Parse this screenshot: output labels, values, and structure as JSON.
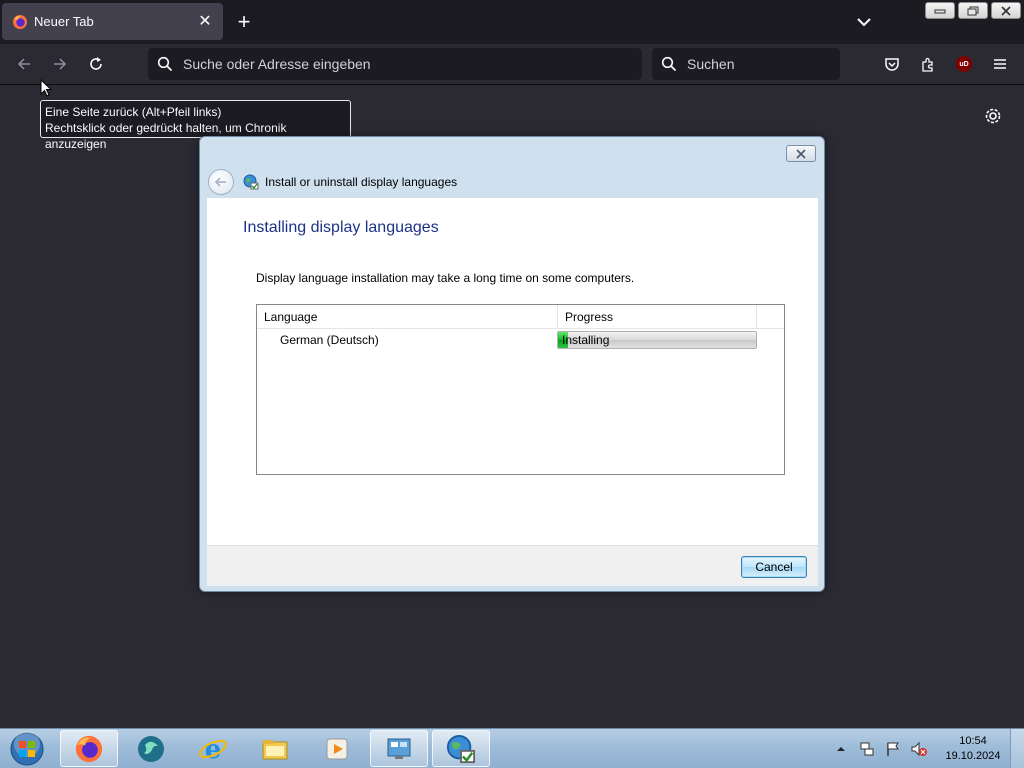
{
  "browser": {
    "tab": {
      "title": "Neuer Tab",
      "icon": "firefox-icon"
    },
    "url_placeholder": "Suche oder Adresse eingeben",
    "search_placeholder": "Suchen",
    "ublock_label": "uD",
    "tooltip": {
      "line1": "Eine Seite zurück (Alt+Pfeil links)",
      "line2": "Rechtsklick oder gedrückt halten, um Chronik anzuzeigen"
    }
  },
  "dialog": {
    "title": "Install or uninstall display languages",
    "heading": "Installing display languages",
    "description": "Display language installation may take a long time on some computers.",
    "columns": [
      "Language",
      "Progress"
    ],
    "rows": [
      {
        "language": "German (Deutsch)",
        "progress_label": "Installing",
        "progress_fraction": 0.05
      }
    ],
    "cancel_label": "Cancel"
  },
  "taskbar": {
    "apps": [
      "firefox",
      "teamviewer-like",
      "internet-explorer",
      "explorer",
      "media-player",
      "control-panel",
      "language-setup"
    ],
    "clock": {
      "time": "10:54",
      "date": "19.10.2024"
    }
  },
  "colors": {
    "browser_bg": "#2b2a33",
    "dialog_heading": "#1e3287",
    "progress_green": "#19b52b"
  }
}
